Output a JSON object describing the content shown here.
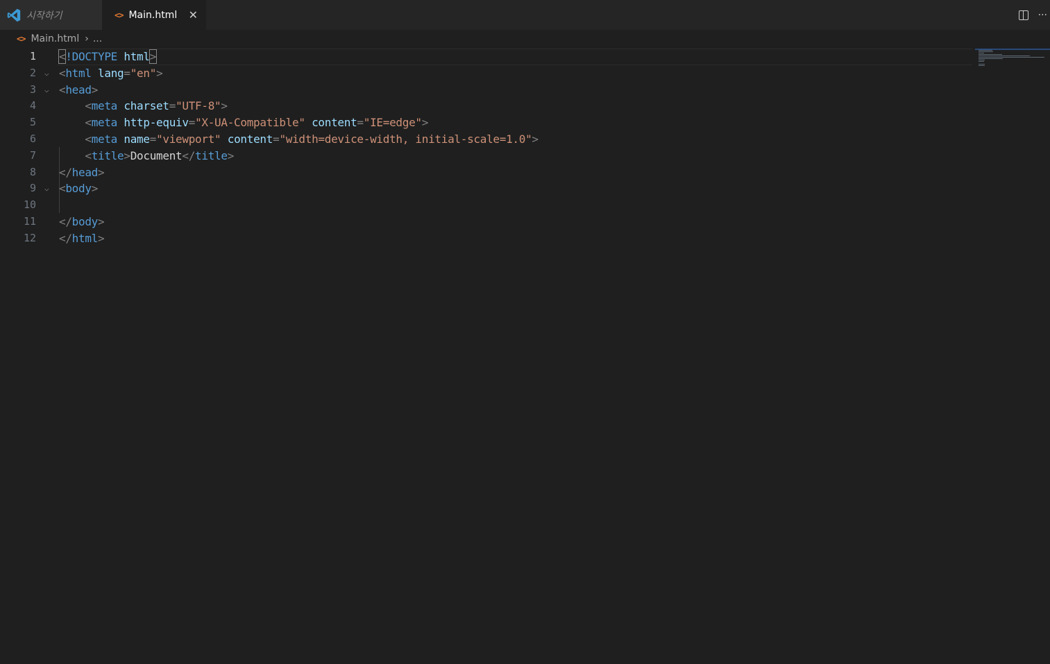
{
  "tabs": [
    {
      "label": "시작하기",
      "active": false
    },
    {
      "label": "Main.html",
      "active": true
    }
  ],
  "breadcrumb": {
    "file": "Main.html",
    "more": "..."
  },
  "editor": {
    "lines": [
      {
        "num": "1",
        "tokens": [
          [
            "punct",
            "<"
          ],
          [
            "tag",
            "!DOCTYPE"
          ],
          [
            "text",
            " "
          ],
          [
            "attr",
            "html"
          ],
          [
            "punct",
            ">"
          ]
        ]
      },
      {
        "num": "2",
        "tokens": [
          [
            "punct",
            "<"
          ],
          [
            "tag",
            "html"
          ],
          [
            "text",
            " "
          ],
          [
            "attr",
            "lang"
          ],
          [
            "punct",
            "="
          ],
          [
            "str",
            "\"en\""
          ],
          [
            "punct",
            ">"
          ]
        ]
      },
      {
        "num": "3",
        "tokens": [
          [
            "punct",
            "<"
          ],
          [
            "tag",
            "head"
          ],
          [
            "punct",
            ">"
          ]
        ]
      },
      {
        "num": "4",
        "tokens": [
          [
            "text",
            "    "
          ],
          [
            "punct",
            "<"
          ],
          [
            "tag",
            "meta"
          ],
          [
            "text",
            " "
          ],
          [
            "attr",
            "charset"
          ],
          [
            "punct",
            "="
          ],
          [
            "str",
            "\"UTF-8\""
          ],
          [
            "punct",
            ">"
          ]
        ]
      },
      {
        "num": "5",
        "tokens": [
          [
            "text",
            "    "
          ],
          [
            "punct",
            "<"
          ],
          [
            "tag",
            "meta"
          ],
          [
            "text",
            " "
          ],
          [
            "attr",
            "http-equiv"
          ],
          [
            "punct",
            "="
          ],
          [
            "str",
            "\"X-UA-Compatible\""
          ],
          [
            "text",
            " "
          ],
          [
            "attr",
            "content"
          ],
          [
            "punct",
            "="
          ],
          [
            "str",
            "\"IE=edge\""
          ],
          [
            "punct",
            ">"
          ]
        ]
      },
      {
        "num": "6",
        "tokens": [
          [
            "text",
            "    "
          ],
          [
            "punct",
            "<"
          ],
          [
            "tag",
            "meta"
          ],
          [
            "text",
            " "
          ],
          [
            "attr",
            "name"
          ],
          [
            "punct",
            "="
          ],
          [
            "str",
            "\"viewport\""
          ],
          [
            "text",
            " "
          ],
          [
            "attr",
            "content"
          ],
          [
            "punct",
            "="
          ],
          [
            "str",
            "\"width=device-width, initial-scale=1.0\""
          ],
          [
            "punct",
            ">"
          ]
        ]
      },
      {
        "num": "7",
        "tokens": [
          [
            "text",
            "    "
          ],
          [
            "punct",
            "<"
          ],
          [
            "tag",
            "title"
          ],
          [
            "punct",
            ">"
          ],
          [
            "text",
            "Document"
          ],
          [
            "punct",
            "</"
          ],
          [
            "tag",
            "title"
          ],
          [
            "punct",
            ">"
          ]
        ]
      },
      {
        "num": "8",
        "tokens": [
          [
            "punct",
            "</"
          ],
          [
            "tag",
            "head"
          ],
          [
            "punct",
            ">"
          ]
        ]
      },
      {
        "num": "9",
        "tokens": [
          [
            "punct",
            "<"
          ],
          [
            "tag",
            "body"
          ],
          [
            "punct",
            ">"
          ]
        ]
      },
      {
        "num": "10",
        "tokens": []
      },
      {
        "num": "11",
        "tokens": [
          [
            "punct",
            "</"
          ],
          [
            "tag",
            "body"
          ],
          [
            "punct",
            ">"
          ]
        ]
      },
      {
        "num": "12",
        "tokens": [
          [
            "punct",
            "</"
          ],
          [
            "tag",
            "html"
          ],
          [
            "punct",
            ">"
          ]
        ]
      }
    ]
  },
  "colors": {
    "background": "#1f1f1f",
    "tag": "#569cd6",
    "attribute": "#9cdcfe",
    "string": "#ce9178",
    "punctuation": "#808080",
    "html_icon": "#e37933",
    "vscode_logo": "#3c99d4"
  },
  "icons": {
    "vscode": "vscode-logo-icon",
    "html_file": "html-file-icon",
    "close": "close-icon",
    "split": "split-editor-icon",
    "more": "more-actions-icon",
    "chevron": "chevron-right-icon",
    "fold": "chevron-down-icon"
  }
}
